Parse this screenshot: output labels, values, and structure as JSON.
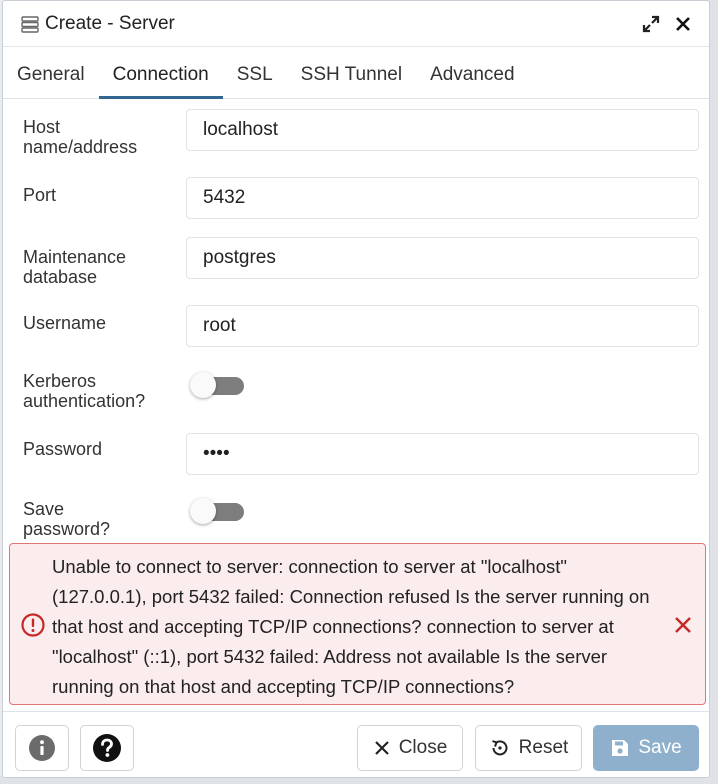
{
  "window": {
    "title": "Create - Server"
  },
  "tabs": [
    {
      "label": "General",
      "active": false
    },
    {
      "label": "Connection",
      "active": true
    },
    {
      "label": "SSL",
      "active": false
    },
    {
      "label": "SSH Tunnel",
      "active": false
    },
    {
      "label": "Advanced",
      "active": false
    }
  ],
  "form": {
    "host": {
      "label_line1": "Host",
      "label_line2": "name/address",
      "value": "localhost"
    },
    "port": {
      "label": "Port",
      "value": "5432"
    },
    "maintenance_db": {
      "label_line1": "Maintenance",
      "label_line2": "database",
      "value": "postgres"
    },
    "username": {
      "label": "Username",
      "value": "root"
    },
    "kerberos": {
      "label_line1": "Kerberos",
      "label_line2": "authentication?",
      "enabled": false
    },
    "password": {
      "label": "Password",
      "value": "••••"
    },
    "save_password": {
      "label_line1": "Save",
      "label_line2": "password?",
      "enabled": false
    }
  },
  "error": {
    "message": "Unable to connect to server: connection to server at \"localhost\" (127.0.0.1), port 5432 failed: Connection refused Is the server running on that host and accepting TCP/IP connections? connection to server at \"localhost\" (::1), port 5432 failed: Address not available Is the server running on that host and accepting TCP/IP connections?",
    "color": "#e27575"
  },
  "footer": {
    "close_label": "Close",
    "reset_label": "Reset",
    "save_label": "Save"
  },
  "colors": {
    "accent": "#326690",
    "save_disabled": "#8fb0cc",
    "error_bg": "#fbeced",
    "error_icon": "#c62828"
  }
}
